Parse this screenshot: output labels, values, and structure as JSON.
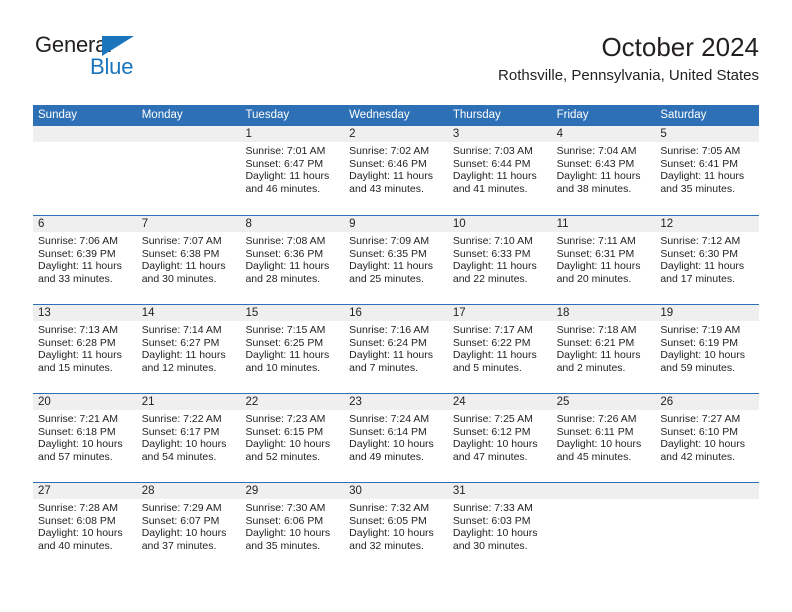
{
  "brand": {
    "name_part1": "General",
    "name_part2": "Blue",
    "triangle_icon": "triangle-icon",
    "accent_color": "#1b75bc"
  },
  "header": {
    "title": "October 2024",
    "subtitle": "Rothsville, Pennsylvania, United States"
  },
  "theme": {
    "header_blue": "#2e70b5",
    "daynum_band_gray": "#efefef",
    "text_color": "#231f20"
  },
  "calendar": {
    "weekday_headers": [
      "Sunday",
      "Monday",
      "Tuesday",
      "Wednesday",
      "Thursday",
      "Friday",
      "Saturday"
    ],
    "weeks": [
      [
        {
          "day": "",
          "sunrise": "",
          "sunset": "",
          "daylight": ""
        },
        {
          "day": "",
          "sunrise": "",
          "sunset": "",
          "daylight": ""
        },
        {
          "day": "1",
          "sunrise": "Sunrise: 7:01 AM",
          "sunset": "Sunset: 6:47 PM",
          "daylight": "Daylight: 11 hours and 46 minutes."
        },
        {
          "day": "2",
          "sunrise": "Sunrise: 7:02 AM",
          "sunset": "Sunset: 6:46 PM",
          "daylight": "Daylight: 11 hours and 43 minutes."
        },
        {
          "day": "3",
          "sunrise": "Sunrise: 7:03 AM",
          "sunset": "Sunset: 6:44 PM",
          "daylight": "Daylight: 11 hours and 41 minutes."
        },
        {
          "day": "4",
          "sunrise": "Sunrise: 7:04 AM",
          "sunset": "Sunset: 6:43 PM",
          "daylight": "Daylight: 11 hours and 38 minutes."
        },
        {
          "day": "5",
          "sunrise": "Sunrise: 7:05 AM",
          "sunset": "Sunset: 6:41 PM",
          "daylight": "Daylight: 11 hours and 35 minutes."
        }
      ],
      [
        {
          "day": "6",
          "sunrise": "Sunrise: 7:06 AM",
          "sunset": "Sunset: 6:39 PM",
          "daylight": "Daylight: 11 hours and 33 minutes."
        },
        {
          "day": "7",
          "sunrise": "Sunrise: 7:07 AM",
          "sunset": "Sunset: 6:38 PM",
          "daylight": "Daylight: 11 hours and 30 minutes."
        },
        {
          "day": "8",
          "sunrise": "Sunrise: 7:08 AM",
          "sunset": "Sunset: 6:36 PM",
          "daylight": "Daylight: 11 hours and 28 minutes."
        },
        {
          "day": "9",
          "sunrise": "Sunrise: 7:09 AM",
          "sunset": "Sunset: 6:35 PM",
          "daylight": "Daylight: 11 hours and 25 minutes."
        },
        {
          "day": "10",
          "sunrise": "Sunrise: 7:10 AM",
          "sunset": "Sunset: 6:33 PM",
          "daylight": "Daylight: 11 hours and 22 minutes."
        },
        {
          "day": "11",
          "sunrise": "Sunrise: 7:11 AM",
          "sunset": "Sunset: 6:31 PM",
          "daylight": "Daylight: 11 hours and 20 minutes."
        },
        {
          "day": "12",
          "sunrise": "Sunrise: 7:12 AM",
          "sunset": "Sunset: 6:30 PM",
          "daylight": "Daylight: 11 hours and 17 minutes."
        }
      ],
      [
        {
          "day": "13",
          "sunrise": "Sunrise: 7:13 AM",
          "sunset": "Sunset: 6:28 PM",
          "daylight": "Daylight: 11 hours and 15 minutes."
        },
        {
          "day": "14",
          "sunrise": "Sunrise: 7:14 AM",
          "sunset": "Sunset: 6:27 PM",
          "daylight": "Daylight: 11 hours and 12 minutes."
        },
        {
          "day": "15",
          "sunrise": "Sunrise: 7:15 AM",
          "sunset": "Sunset: 6:25 PM",
          "daylight": "Daylight: 11 hours and 10 minutes."
        },
        {
          "day": "16",
          "sunrise": "Sunrise: 7:16 AM",
          "sunset": "Sunset: 6:24 PM",
          "daylight": "Daylight: 11 hours and 7 minutes."
        },
        {
          "day": "17",
          "sunrise": "Sunrise: 7:17 AM",
          "sunset": "Sunset: 6:22 PM",
          "daylight": "Daylight: 11 hours and 5 minutes."
        },
        {
          "day": "18",
          "sunrise": "Sunrise: 7:18 AM",
          "sunset": "Sunset: 6:21 PM",
          "daylight": "Daylight: 11 hours and 2 minutes."
        },
        {
          "day": "19",
          "sunrise": "Sunrise: 7:19 AM",
          "sunset": "Sunset: 6:19 PM",
          "daylight": "Daylight: 10 hours and 59 minutes."
        }
      ],
      [
        {
          "day": "20",
          "sunrise": "Sunrise: 7:21 AM",
          "sunset": "Sunset: 6:18 PM",
          "daylight": "Daylight: 10 hours and 57 minutes."
        },
        {
          "day": "21",
          "sunrise": "Sunrise: 7:22 AM",
          "sunset": "Sunset: 6:17 PM",
          "daylight": "Daylight: 10 hours and 54 minutes."
        },
        {
          "day": "22",
          "sunrise": "Sunrise: 7:23 AM",
          "sunset": "Sunset: 6:15 PM",
          "daylight": "Daylight: 10 hours and 52 minutes."
        },
        {
          "day": "23",
          "sunrise": "Sunrise: 7:24 AM",
          "sunset": "Sunset: 6:14 PM",
          "daylight": "Daylight: 10 hours and 49 minutes."
        },
        {
          "day": "24",
          "sunrise": "Sunrise: 7:25 AM",
          "sunset": "Sunset: 6:12 PM",
          "daylight": "Daylight: 10 hours and 47 minutes."
        },
        {
          "day": "25",
          "sunrise": "Sunrise: 7:26 AM",
          "sunset": "Sunset: 6:11 PM",
          "daylight": "Daylight: 10 hours and 45 minutes."
        },
        {
          "day": "26",
          "sunrise": "Sunrise: 7:27 AM",
          "sunset": "Sunset: 6:10 PM",
          "daylight": "Daylight: 10 hours and 42 minutes."
        }
      ],
      [
        {
          "day": "27",
          "sunrise": "Sunrise: 7:28 AM",
          "sunset": "Sunset: 6:08 PM",
          "daylight": "Daylight: 10 hours and 40 minutes."
        },
        {
          "day": "28",
          "sunrise": "Sunrise: 7:29 AM",
          "sunset": "Sunset: 6:07 PM",
          "daylight": "Daylight: 10 hours and 37 minutes."
        },
        {
          "day": "29",
          "sunrise": "Sunrise: 7:30 AM",
          "sunset": "Sunset: 6:06 PM",
          "daylight": "Daylight: 10 hours and 35 minutes."
        },
        {
          "day": "30",
          "sunrise": "Sunrise: 7:32 AM",
          "sunset": "Sunset: 6:05 PM",
          "daylight": "Daylight: 10 hours and 32 minutes."
        },
        {
          "day": "31",
          "sunrise": "Sunrise: 7:33 AM",
          "sunset": "Sunset: 6:03 PM",
          "daylight": "Daylight: 10 hours and 30 minutes."
        },
        {
          "day": "",
          "sunrise": "",
          "sunset": "",
          "daylight": ""
        },
        {
          "day": "",
          "sunrise": "",
          "sunset": "",
          "daylight": ""
        }
      ]
    ]
  }
}
